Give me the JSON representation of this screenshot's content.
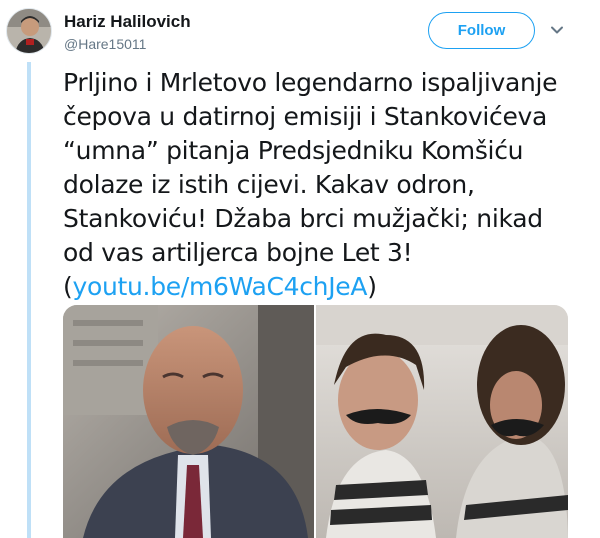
{
  "user": {
    "name": "Hariz Halilovich",
    "handle": "@Hare15011"
  },
  "actions": {
    "follow_label": "Follow"
  },
  "tweet": {
    "lines": [
      "Prljino i Mrletovo legendarno ispaljivanje",
      "čepova u datirnoj emisiji i Stankovićeva",
      "“umna” pitanja Predsjedniku Komšiću",
      "dolaze iz istih cijevi. Kakav odron,",
      "Stankoviću! Džaba brci mužjački; nikad",
      "od vas artiljerca bojne Let 3!"
    ],
    "link_open": "(",
    "link_text": "youtu.be/m6WaC4chJeA",
    "link_close": ")"
  },
  "colors": {
    "accent": "#1da1f2",
    "thread_line": "#bfe0f7"
  },
  "icons": {
    "menu": "chevron-down-icon"
  }
}
